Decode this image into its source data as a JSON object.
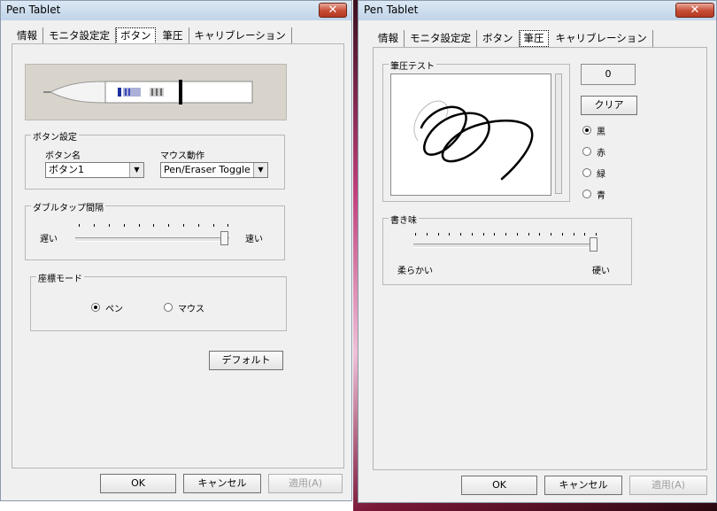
{
  "left_window": {
    "title": "Pen Tablet",
    "close_label": "✕",
    "tabs": [
      {
        "label": "情報",
        "active": false
      },
      {
        "label": "モニタ設定定",
        "active": false
      },
      {
        "label": "ボタン",
        "active": true
      },
      {
        "label": "筆圧",
        "active": false
      },
      {
        "label": "キャリブレーション",
        "active": false
      }
    ],
    "button_settings": {
      "group_label": "ボタン設定",
      "button_name_label": "ボタン名",
      "button_name_value": "ボタン1",
      "mouse_action_label": "マウス動作",
      "mouse_action_value": "Pen/Eraser Toggle"
    },
    "double_tap": {
      "group_label": "ダブルタップ間隔",
      "slow_label": "遅い",
      "fast_label": "速い",
      "level": 1.0
    },
    "coord_mode": {
      "group_label": "座標モード",
      "options": [
        {
          "label": "ペン",
          "selected": true
        },
        {
          "label": "マウス",
          "selected": false
        }
      ]
    },
    "default_label": "デフォルト",
    "ok_label": "OK",
    "cancel_label": "キャンセル",
    "apply_label": "適用(A)"
  },
  "right_window": {
    "title": "Pen Tablet",
    "close_label": "✕",
    "tabs": [
      {
        "label": "情報",
        "active": false
      },
      {
        "label": "モニタ設定定",
        "active": false
      },
      {
        "label": "ボタン",
        "active": false
      },
      {
        "label": "筆圧",
        "active": true
      },
      {
        "label": "キャリブレーション",
        "active": false
      }
    ],
    "pressure_test": {
      "group_label": "筆圧テスト",
      "pressure_value": "0",
      "clear_label": "クリア",
      "colors": [
        {
          "label": "黒",
          "selected": true
        },
        {
          "label": "赤",
          "selected": false
        },
        {
          "label": "緑",
          "selected": false
        },
        {
          "label": "青",
          "selected": false
        }
      ]
    },
    "feel": {
      "group_label": "書き味",
      "soft_label": "柔らかい",
      "hard_label": "硬い",
      "level": 1.0
    },
    "ok_label": "OK",
    "cancel_label": "キャンセル",
    "apply_label": "適用(A)"
  },
  "colors": {
    "window_bg": "#f0f0f0",
    "desktop_accent": "#c0407a",
    "close_button": "#c74b33"
  }
}
